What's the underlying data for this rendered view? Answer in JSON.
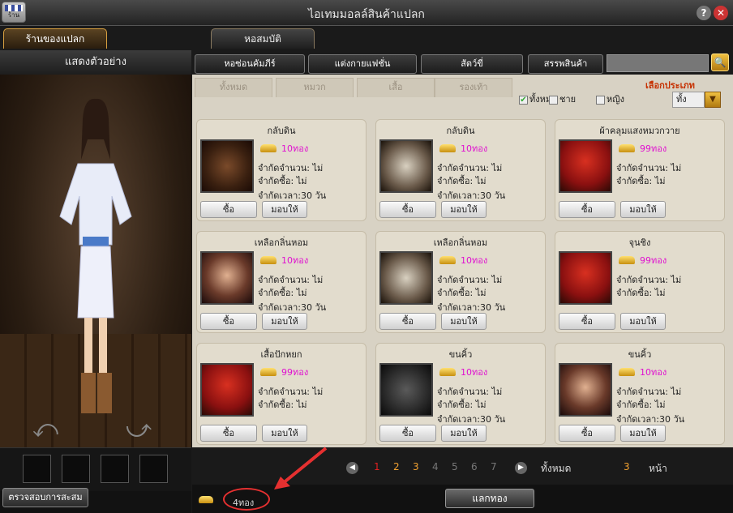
{
  "window": {
    "title": "ไอเทมมอลล์สินค้าแปลก",
    "logo_text": "ร้าน",
    "help": "?",
    "close": "✕"
  },
  "top_tabs": [
    {
      "label": "ร้านของแปลก",
      "active": true
    },
    {
      "label": "หอสมบัติ",
      "active": false
    }
  ],
  "left": {
    "header": "แสดงตัวอย่าง",
    "check_button": "ตรวจสอบการสะสม"
  },
  "categories": [
    "หอซ่อนคัมภีร์",
    "แต่งกายแฟชั่น",
    "สัตว์ขี่",
    "สรรพสินค้า"
  ],
  "subtabs": [
    "ทั้งหมด",
    "หมวก",
    "เสื้อ",
    "รองเท้า"
  ],
  "checks": [
    {
      "label": "ทั้งหมด",
      "checked": true
    },
    {
      "label": "ชาย",
      "checked": false
    },
    {
      "label": "หญิง",
      "checked": false
    }
  ],
  "filter": {
    "label": "เลือกประเภท",
    "value": "ทั้ง"
  },
  "items": [
    {
      "name": "กลับดิน",
      "price": "10ทอง",
      "qty": "จำกัดจำนวน: ไม่",
      "buy": "จำกัดซื้อ: ไม่",
      "time": "จำกัดเวลา:30 วัน",
      "img": "boots"
    },
    {
      "name": "กลับดิน",
      "price": "10ทอง",
      "qty": "จำกัดจำนวน: ไม่",
      "buy": "จำกัดซื้อ: ไม่",
      "time": "จำกัดเวลา:30 วัน",
      "img": "white"
    },
    {
      "name": "ผ้าคลุมแสงหมวกวาย",
      "price": "99ทอง",
      "qty": "จำกัดจำนวน: ไม่",
      "buy": "จำกัดซื้อ: ไม่",
      "time": "",
      "img": "red"
    },
    {
      "name": "เหลือกลิ่นหอม",
      "price": "10ทอง",
      "qty": "จำกัดจำนวน: ไม่",
      "buy": "จำกัดซื้อ: ไม่",
      "time": "จำกัดเวลา:30 วัน",
      "img": "face"
    },
    {
      "name": "เหลือกลิ่นหอม",
      "price": "10ทอง",
      "qty": "จำกัดจำนวน: ไม่",
      "buy": "จำกัดซื้อ: ไม่",
      "time": "จำกัดเวลา:30 วัน",
      "img": "white"
    },
    {
      "name": "จุนชิง",
      "price": "99ทอง",
      "qty": "จำกัดจำนวน: ไม่",
      "buy": "จำกัดซื้อ: ไม่",
      "time": "",
      "img": "red"
    },
    {
      "name": "เสื้อปักหยก",
      "price": "99ทอง",
      "qty": "จำกัดจำนวน: ไม่",
      "buy": "จำกัดซื้อ: ไม่",
      "time": "",
      "img": "red"
    },
    {
      "name": "ขนคิ้ว",
      "price": "10ทอง",
      "qty": "จำกัดจำนวน: ไม่",
      "buy": "จำกัดซื้อ: ไม่",
      "time": "จำกัดเวลา:30 วัน",
      "img": "dark"
    },
    {
      "name": "ขนคิ้ว",
      "price": "10ทอง",
      "qty": "จำกัดจำนวน: ไม่",
      "buy": "จำกัดซื้อ: ไม่",
      "time": "จำกัดเวลา:30 วัน",
      "img": "face"
    }
  ],
  "buttons": {
    "buy": "ซื้อ",
    "gift": "มอบให้"
  },
  "pager": {
    "pages": [
      "1",
      "2",
      "3",
      "4",
      "5",
      "6",
      "7"
    ],
    "current": "1",
    "total_label": "ทั้งหมด",
    "total": "3",
    "page_label": "หน้า"
  },
  "footer": {
    "gold": "4ทอง",
    "exchange": "แลกทอง"
  },
  "colors": {
    "price": "#e010d0",
    "filter_label": "#c63000",
    "annotation": "#e53030"
  }
}
